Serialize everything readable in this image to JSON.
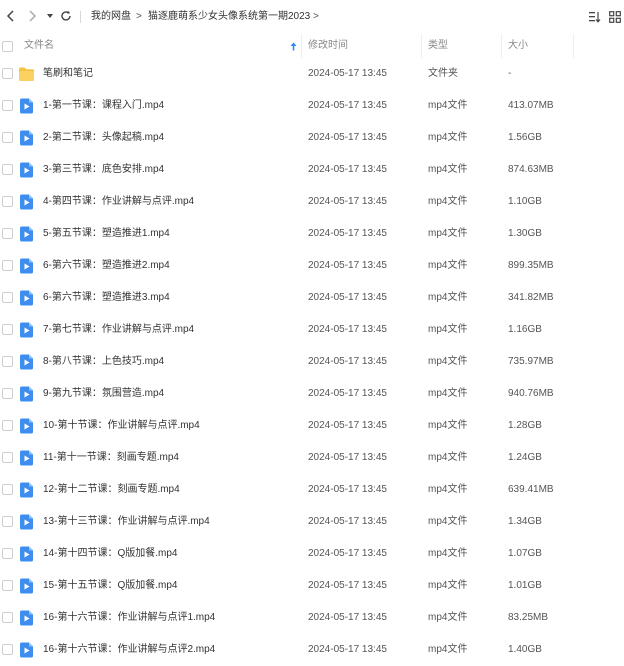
{
  "toolbar": {
    "back_icon": "chevron-left-icon",
    "forward_icon": "chevron-right-icon",
    "history_icon": "caret-down-icon",
    "refresh_icon": "refresh-icon",
    "breadcrumb": [
      "我的网盘",
      "猫逐鹿萌系少女头像系统第一期2023"
    ],
    "sort_icon": "sort-list-icon",
    "grid_icon": "grid-view-icon"
  },
  "columns": {
    "name": "文件名",
    "modified": "修改时间",
    "type": "类型",
    "size": "大小"
  },
  "colors": {
    "folder": "#f5c342",
    "video": "#3d8ef0",
    "sort_arrow": "#2f86f6"
  },
  "files": [
    {
      "icon": "folder-icon",
      "name": "笔刷和笔记",
      "modified": "2024-05-17 13:45",
      "type": "文件夹",
      "size": "-"
    },
    {
      "icon": "video-file-icon",
      "name": "1-第一节课：课程入门.mp4",
      "modified": "2024-05-17 13:45",
      "type": "mp4文件",
      "size": "413.07MB"
    },
    {
      "icon": "video-file-icon",
      "name": "2-第二节课：头像起稿.mp4",
      "modified": "2024-05-17 13:45",
      "type": "mp4文件",
      "size": "1.56GB"
    },
    {
      "icon": "video-file-icon",
      "name": "3-第三节课：底色安排.mp4",
      "modified": "2024-05-17 13:45",
      "type": "mp4文件",
      "size": "874.63MB"
    },
    {
      "icon": "video-file-icon",
      "name": "4-第四节课：作业讲解与点评.mp4",
      "modified": "2024-05-17 13:45",
      "type": "mp4文件",
      "size": "1.10GB"
    },
    {
      "icon": "video-file-icon",
      "name": "5-第五节课：塑造推进1.mp4",
      "modified": "2024-05-17 13:45",
      "type": "mp4文件",
      "size": "1.30GB"
    },
    {
      "icon": "video-file-icon",
      "name": "6-第六节课：塑造推进2.mp4",
      "modified": "2024-05-17 13:45",
      "type": "mp4文件",
      "size": "899.35MB"
    },
    {
      "icon": "video-file-icon",
      "name": "6-第六节课：塑造推进3.mp4",
      "modified": "2024-05-17 13:45",
      "type": "mp4文件",
      "size": "341.82MB"
    },
    {
      "icon": "video-file-icon",
      "name": "7-第七节课：作业讲解与点评.mp4",
      "modified": "2024-05-17 13:45",
      "type": "mp4文件",
      "size": "1.16GB"
    },
    {
      "icon": "video-file-icon",
      "name": "8-第八节课：上色技巧.mp4",
      "modified": "2024-05-17 13:45",
      "type": "mp4文件",
      "size": "735.97MB"
    },
    {
      "icon": "video-file-icon",
      "name": "9-第九节课：氛围营造.mp4",
      "modified": "2024-05-17 13:45",
      "type": "mp4文件",
      "size": "940.76MB"
    },
    {
      "icon": "video-file-icon",
      "name": "10-第十节课：作业讲解与点评.mp4",
      "modified": "2024-05-17 13:45",
      "type": "mp4文件",
      "size": "1.28GB"
    },
    {
      "icon": "video-file-icon",
      "name": "11-第十一节课：刻画专题.mp4",
      "modified": "2024-05-17 13:45",
      "type": "mp4文件",
      "size": "1.24GB"
    },
    {
      "icon": "video-file-icon",
      "name": "12-第十二节课：刻画专题.mp4",
      "modified": "2024-05-17 13:45",
      "type": "mp4文件",
      "size": "639.41MB"
    },
    {
      "icon": "video-file-icon",
      "name": "13-第十三节课：作业讲解与点评.mp4",
      "modified": "2024-05-17 13:45",
      "type": "mp4文件",
      "size": "1.34GB"
    },
    {
      "icon": "video-file-icon",
      "name": "14-第十四节课：Q版加餐.mp4",
      "modified": "2024-05-17 13:45",
      "type": "mp4文件",
      "size": "1.07GB"
    },
    {
      "icon": "video-file-icon",
      "name": "15-第十五节课：Q版加餐.mp4",
      "modified": "2024-05-17 13:45",
      "type": "mp4文件",
      "size": "1.01GB"
    },
    {
      "icon": "video-file-icon",
      "name": "16-第十六节课：作业讲解与点评1.mp4",
      "modified": "2024-05-17 13:45",
      "type": "mp4文件",
      "size": "83.25MB"
    },
    {
      "icon": "video-file-icon",
      "name": "16-第十六节课：作业讲解与点评2.mp4",
      "modified": "2024-05-17 13:45",
      "type": "mp4文件",
      "size": "1.40GB"
    }
  ]
}
